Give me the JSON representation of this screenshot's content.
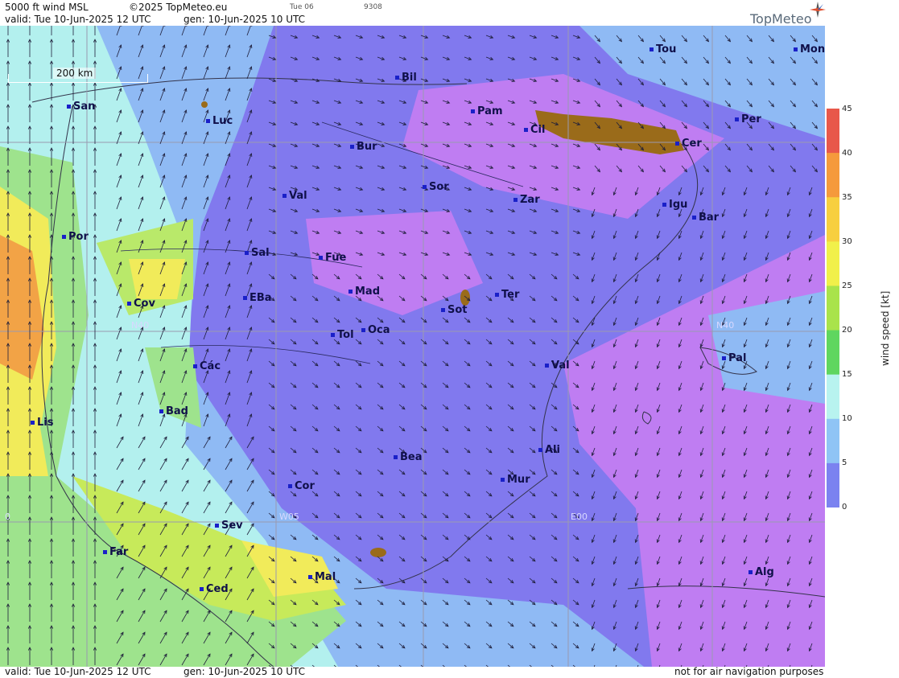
{
  "header": {
    "title": "5000 ft wind MSL",
    "copyright": "©2025 TopMeteo.eu",
    "valid": "valid:  Tue  10-Jun-2025  12 UTC",
    "gen": "gen: 10-Jun-2025 10 UTC",
    "tag1": "Tue 06",
    "tag2": "9308",
    "brand": "TopMeteo"
  },
  "footer": {
    "valid": "valid:  Tue  10-Jun-2025  12 UTC",
    "gen": "gen: 10-Jun-2025 10 UTC",
    "note": "not for air navigation purposes"
  },
  "scale": {
    "label": "200 km"
  },
  "grid_labels": [
    "N40",
    "N40",
    "W05",
    "E00",
    "0"
  ],
  "cities": [
    "Tou",
    "Mon",
    "Bil",
    "San",
    "Luc",
    "Pam",
    "Cil",
    "Per",
    "Bur",
    "Cer",
    "Sor",
    "Val",
    "Zar",
    "Igu",
    "Bar",
    "Por",
    "Sal",
    "Fue",
    "Cov",
    "EBa",
    "Mad",
    "Sot",
    "Ter",
    "Tol",
    "Oca",
    "Các",
    "Val",
    "Pal",
    "Bad",
    "Lis",
    "Bea",
    "Ali",
    "Cor",
    "Mur",
    "Sev",
    "Far",
    "Mal",
    "Ced",
    "Alg"
  ],
  "legend": {
    "unit": "wind speed [kt]",
    "ticks": [
      "45",
      "40",
      "35",
      "30",
      "25",
      "20",
      "15",
      "10",
      "5",
      "0"
    ],
    "colors": [
      "#e8584a",
      "#f59a3c",
      "#f7cf3f",
      "#f1f04a",
      "#a9e34b",
      "#5fd65f",
      "#b8f3ef",
      "#8fc4f5",
      "#7b82f0",
      "#b57af2"
    ]
  }
}
